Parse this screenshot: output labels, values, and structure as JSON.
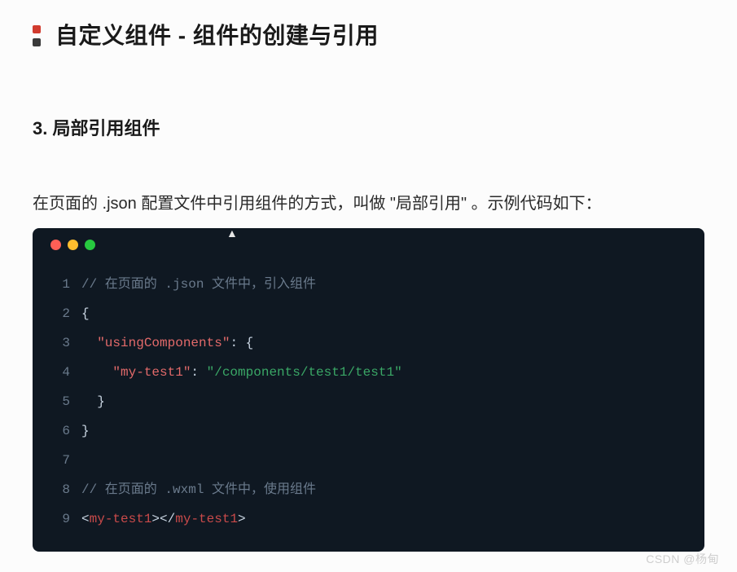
{
  "title": "自定义组件 - 组件的创建与引用",
  "subheading": "3. 局部引用组件",
  "body": "在页面的 .json 配置文件中引用组件的方式，叫做 \"局部引用\" 。示例代码如下：",
  "code": {
    "lines": [
      {
        "n": "1",
        "segments": [
          {
            "cls": "c-comment",
            "t": "// 在页面的 .json 文件中，引入组件"
          }
        ]
      },
      {
        "n": "2",
        "segments": [
          {
            "cls": "c-plain",
            "t": "{"
          }
        ]
      },
      {
        "n": "3",
        "segments": [
          {
            "cls": "c-plain",
            "t": "  "
          },
          {
            "cls": "c-key",
            "t": "\"usingComponents\""
          },
          {
            "cls": "c-plain",
            "t": ": {"
          }
        ]
      },
      {
        "n": "4",
        "segments": [
          {
            "cls": "c-plain",
            "t": "    "
          },
          {
            "cls": "c-key",
            "t": "\"my-test1\""
          },
          {
            "cls": "c-plain",
            "t": ": "
          },
          {
            "cls": "c-string",
            "t": "\"/components/test1/test1\""
          }
        ]
      },
      {
        "n": "5",
        "segments": [
          {
            "cls": "c-plain",
            "t": "  }"
          }
        ]
      },
      {
        "n": "6",
        "segments": [
          {
            "cls": "c-plain",
            "t": "}"
          }
        ]
      },
      {
        "n": "7",
        "segments": [
          {
            "cls": "c-plain",
            "t": ""
          }
        ]
      },
      {
        "n": "8",
        "segments": [
          {
            "cls": "c-comment",
            "t": "// 在页面的 .wxml 文件中，使用组件"
          }
        ]
      },
      {
        "n": "9",
        "segments": [
          {
            "cls": "c-punct",
            "t": "<"
          },
          {
            "cls": "c-tag",
            "t": "my-test1"
          },
          {
            "cls": "c-punct",
            "t": "></"
          },
          {
            "cls": "c-tag",
            "t": "my-test1"
          },
          {
            "cls": "c-punct",
            "t": ">"
          }
        ]
      }
    ]
  },
  "watermark": "CSDN @杨甸"
}
